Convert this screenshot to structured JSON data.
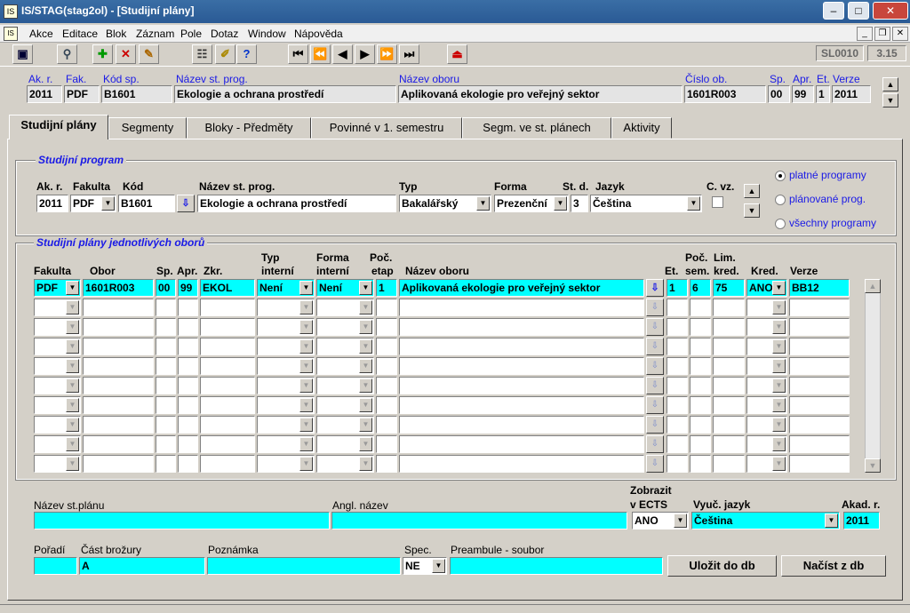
{
  "window": {
    "title": "IS/STAG(stag2ol) - [Studijní plány]",
    "min": "–",
    "max": "□",
    "close": "✕"
  },
  "menu": {
    "items": [
      "Akce",
      "Editace",
      "Blok",
      "Záznam",
      "Pole",
      "Dotaz",
      "Window",
      "Nápověda"
    ],
    "mdi_min": "_",
    "mdi_restore": "❐",
    "mdi_close": "✕"
  },
  "toolbar": {
    "form_code": "SL0010",
    "version": "3.15"
  },
  "header": {
    "labels": {
      "ak_r": "Ak. r.",
      "fak": "Fak.",
      "kod_sp": "Kód sp.",
      "nazev_st_prog": "Název st. prog.",
      "nazev_oboru": "Název oboru",
      "cislo_ob": "Číslo ob.",
      "sp": "Sp.",
      "apr": "Apr.",
      "et": "Et.",
      "verze": "Verze"
    },
    "values": {
      "ak_r": "2011",
      "fak": "PDF",
      "kod_sp": "B1601",
      "nazev_st_prog": "Ekologie a ochrana prostředí",
      "nazev_oboru": "Aplikovaná ekologie pro veřejný sektor",
      "cislo_ob": "1601R003",
      "sp": "00",
      "apr": "99",
      "et": "1",
      "verze": "2011"
    }
  },
  "tabs": [
    "Studijní plány",
    "Segmenty",
    "Bloky - Předměty",
    "Povinné v 1. semestru",
    "Segm. ve st. plánech",
    "Aktivity"
  ],
  "program": {
    "title": "Studijní program",
    "labels": {
      "ak_r": "Ak. r.",
      "fakulta": "Fakulta",
      "kod": "Kód",
      "nazev": "Název st. prog.",
      "typ": "Typ",
      "forma": "Forma",
      "st_d": "St. d.",
      "jazyk": "Jazyk",
      "c_vz": "C. vz."
    },
    "values": {
      "ak_r": "2011",
      "fakulta": "PDF",
      "kod": "B1601",
      "nazev": "Ekologie a ochrana prostředí",
      "typ": "Bakalářský",
      "forma": "Prezenční",
      "st_d": "3",
      "jazyk": "Čeština"
    },
    "radios": [
      "platné programy",
      "plánované prog.",
      "všechny programy"
    ],
    "selected_radio": "platné programy"
  },
  "plans": {
    "title": "Studijní plány jednotlivých oborů",
    "headers": {
      "fakulta": "Fakulta",
      "obor": "Obor",
      "sp": "Sp.",
      "apr": "Apr.",
      "zkr": "Zkr.",
      "typ_1": "Typ",
      "typ_2": "interní",
      "forma_1": "Forma",
      "forma_2": "interní",
      "poc_1": "Poč.",
      "poc_2": "etap",
      "nazev": "Název oboru",
      "et": "Et.",
      "pocsem_1": "Poč.",
      "pocsem_2": "sem.",
      "lim_1": "Lim.",
      "lim_2": "kred.",
      "kred": "Kred.",
      "verze": "Verze"
    },
    "row": {
      "fakulta": "PDF",
      "obor": "1601R003",
      "sp": "00",
      "apr": "99",
      "zkr": "EKOL",
      "typ": "Není",
      "forma": "Není",
      "poc": "1",
      "nazev": "Aplikovaná ekologie pro veřejný sektor",
      "et": "1",
      "pocsem": "6",
      "lim": "75",
      "kred": "ANO",
      "verze": "BB12"
    }
  },
  "bottom": {
    "labels": {
      "nazev": "Název st.plánu",
      "angl": "Angl. název",
      "ects_1": "Zobrazit",
      "ects_2": "v ECTS",
      "jazyk": "Vyuč. jazyk",
      "akad": "Akad. r.",
      "poradi": "Pořadí",
      "cast": "Část brožury",
      "poznamka": "Poznámka",
      "spec": "Spec.",
      "preambule": "Preambule - soubor"
    },
    "values": {
      "nazev": "",
      "angl": "",
      "ects": "ANO",
      "jazyk": "Čeština",
      "akad": "2011",
      "poradi": "",
      "cast": "A",
      "poznamka": "",
      "spec": "NE",
      "preambule": ""
    },
    "buttons": {
      "save": "Uložit do db",
      "load": "Načíst z db"
    }
  }
}
